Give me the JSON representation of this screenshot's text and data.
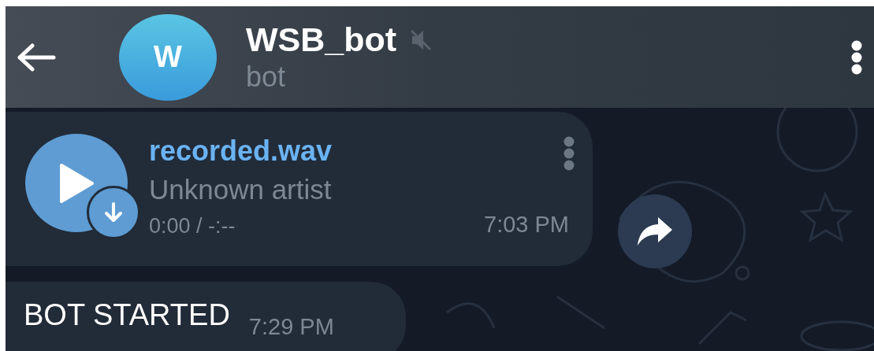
{
  "header": {
    "avatar_letter": "W",
    "title": "WSB_bot",
    "muted": true,
    "subtitle": "bot"
  },
  "messages": [
    {
      "kind": "audio",
      "filename": "recorded.wav",
      "artist": "Unknown artist",
      "duration": "0:00 / -:--",
      "time": "7:03 PM"
    },
    {
      "kind": "text",
      "text": "BOT STARTED",
      "time": "7:29 PM"
    }
  ]
}
